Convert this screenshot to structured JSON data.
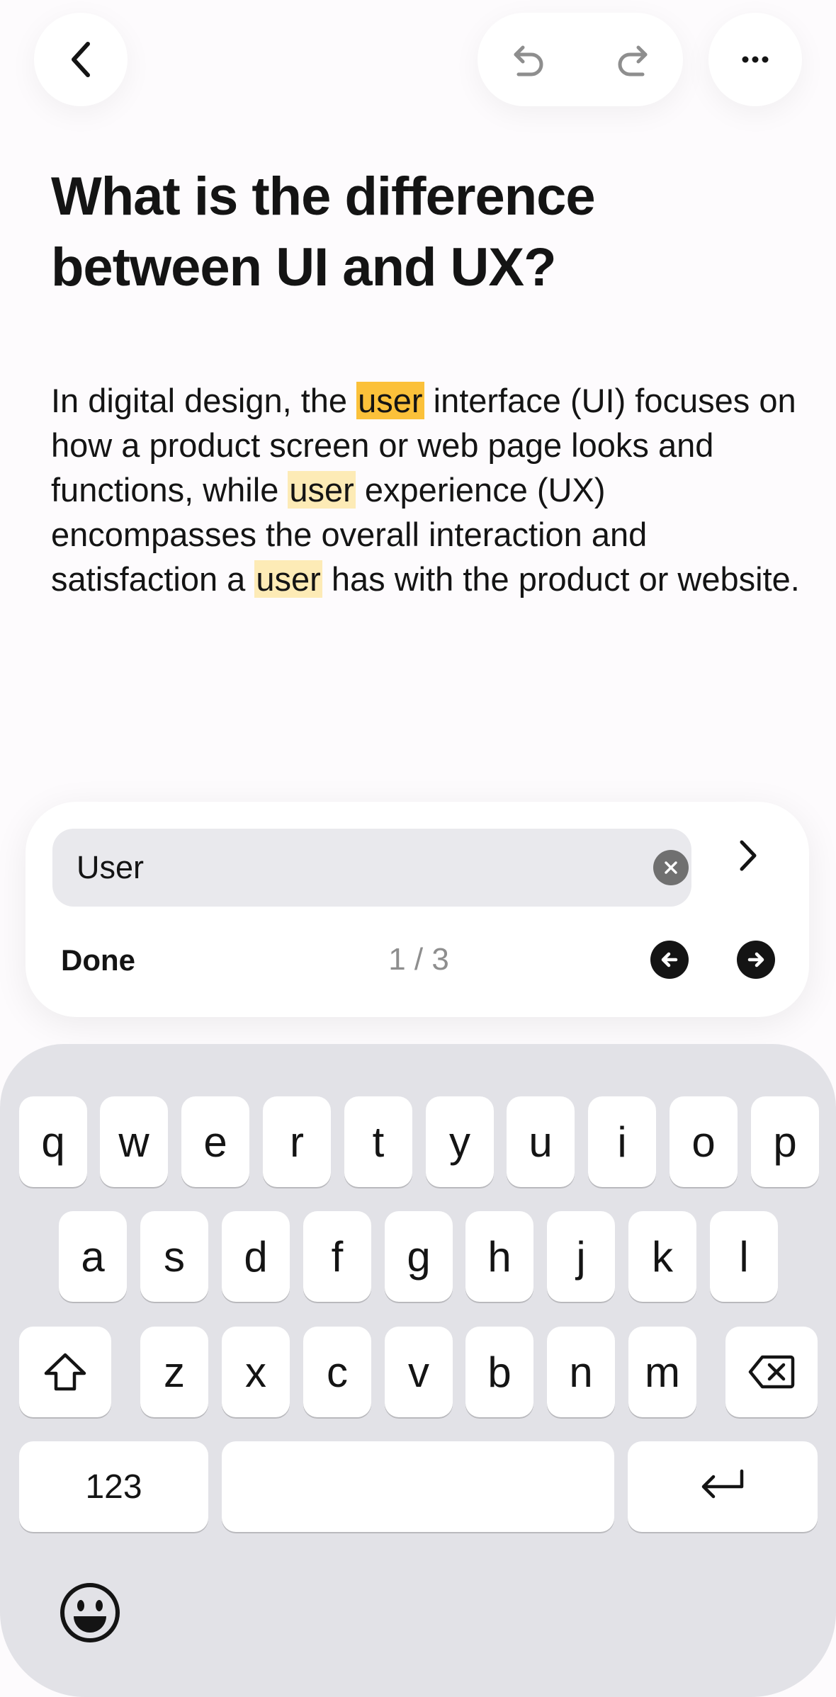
{
  "toolbar": {
    "back_icon": "chevron-left-icon",
    "undo_icon": "undo-icon",
    "redo_icon": "redo-icon",
    "more_icon": "more-horizontal-icon"
  },
  "document": {
    "title": "What is the difference between UI and UX?",
    "body": {
      "p1": "In digital design, the ",
      "m1": "user",
      "p2": " interface (UI) focuses on how a product screen or web page looks and functions, while ",
      "m2": "user",
      "p3": " experience (UX) encompasses the overall interaction and satisfaction a ",
      "m3": "user",
      "p4": " has with the product or website."
    },
    "highlight_colors": {
      "current": "#fbc13a",
      "other": "#fdebb6"
    }
  },
  "find": {
    "query": "User",
    "placeholder": "Find in document",
    "done_label": "Done",
    "counter": "1 / 3",
    "clear_icon": "clear-icon",
    "submit_icon": "chevron-right-icon",
    "prev_icon": "arrow-left-circle-icon",
    "next_icon": "arrow-right-circle-icon"
  },
  "keyboard": {
    "row1": [
      "q",
      "w",
      "e",
      "r",
      "t",
      "y",
      "u",
      "i",
      "o",
      "p"
    ],
    "row2": [
      "a",
      "s",
      "d",
      "f",
      "g",
      "h",
      "j",
      "k",
      "l"
    ],
    "row3": [
      "z",
      "x",
      "c",
      "v",
      "b",
      "n",
      "m"
    ],
    "numbers_label": "123",
    "shift_icon": "shift-icon",
    "backspace_icon": "backspace-icon",
    "return_icon": "return-icon",
    "emoji_icon": "emoji-icon"
  }
}
